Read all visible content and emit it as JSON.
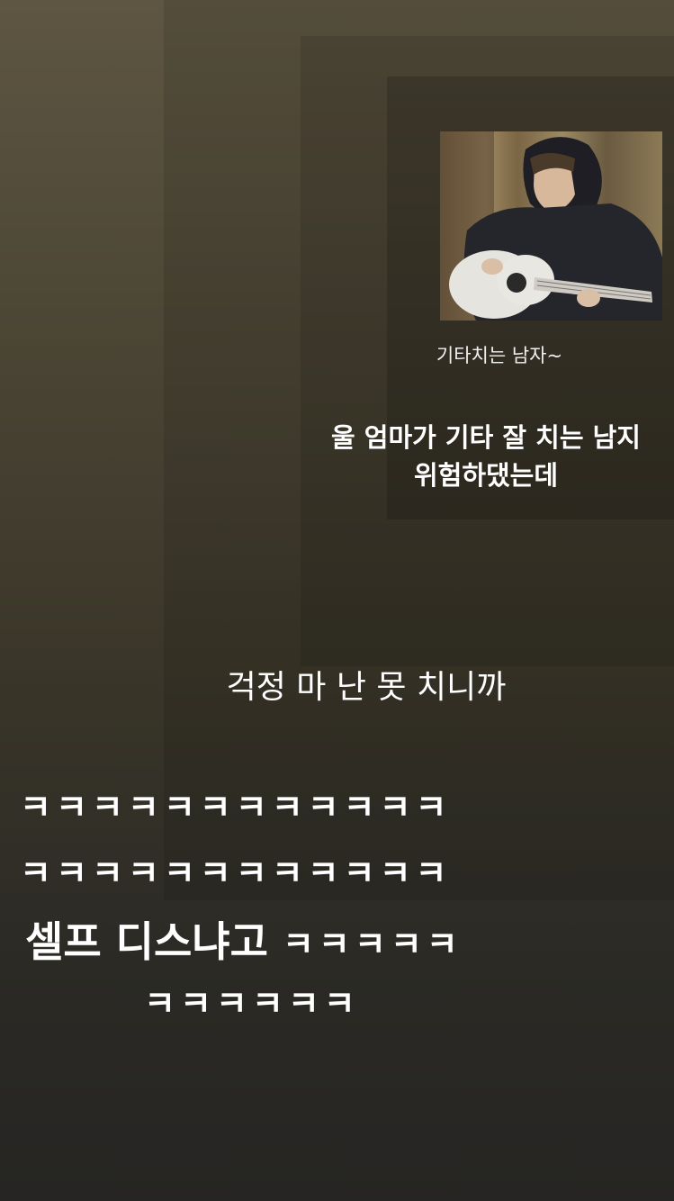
{
  "story": {
    "photo": {
      "icon": "person-playing-guitar-photo",
      "colors": {
        "hoodie": "#23232a",
        "guitar": "#e8e6e1",
        "curtain": "#8f7a55"
      }
    },
    "caption": "기타치는 남자~",
    "message_line1": "울 엄마가 기타 잘 치는 남지",
    "message_line2": "위험하댔는데",
    "reply": "걱정 마 난 못 치니까",
    "laugh_row1": "ㅋㅋㅋㅋㅋㅋㅋㅋㅋㅋㅋㅋ",
    "laugh_row2": "ㅋㅋㅋㅋㅋㅋㅋㅋㅋㅋㅋㅋ",
    "self_diss": "셀프 디스냐고",
    "self_diss_laugh": "ㅋㅋㅋㅋㅋ",
    "laugh_row3": "ㅋㅋㅋㅋㅋㅋ"
  }
}
